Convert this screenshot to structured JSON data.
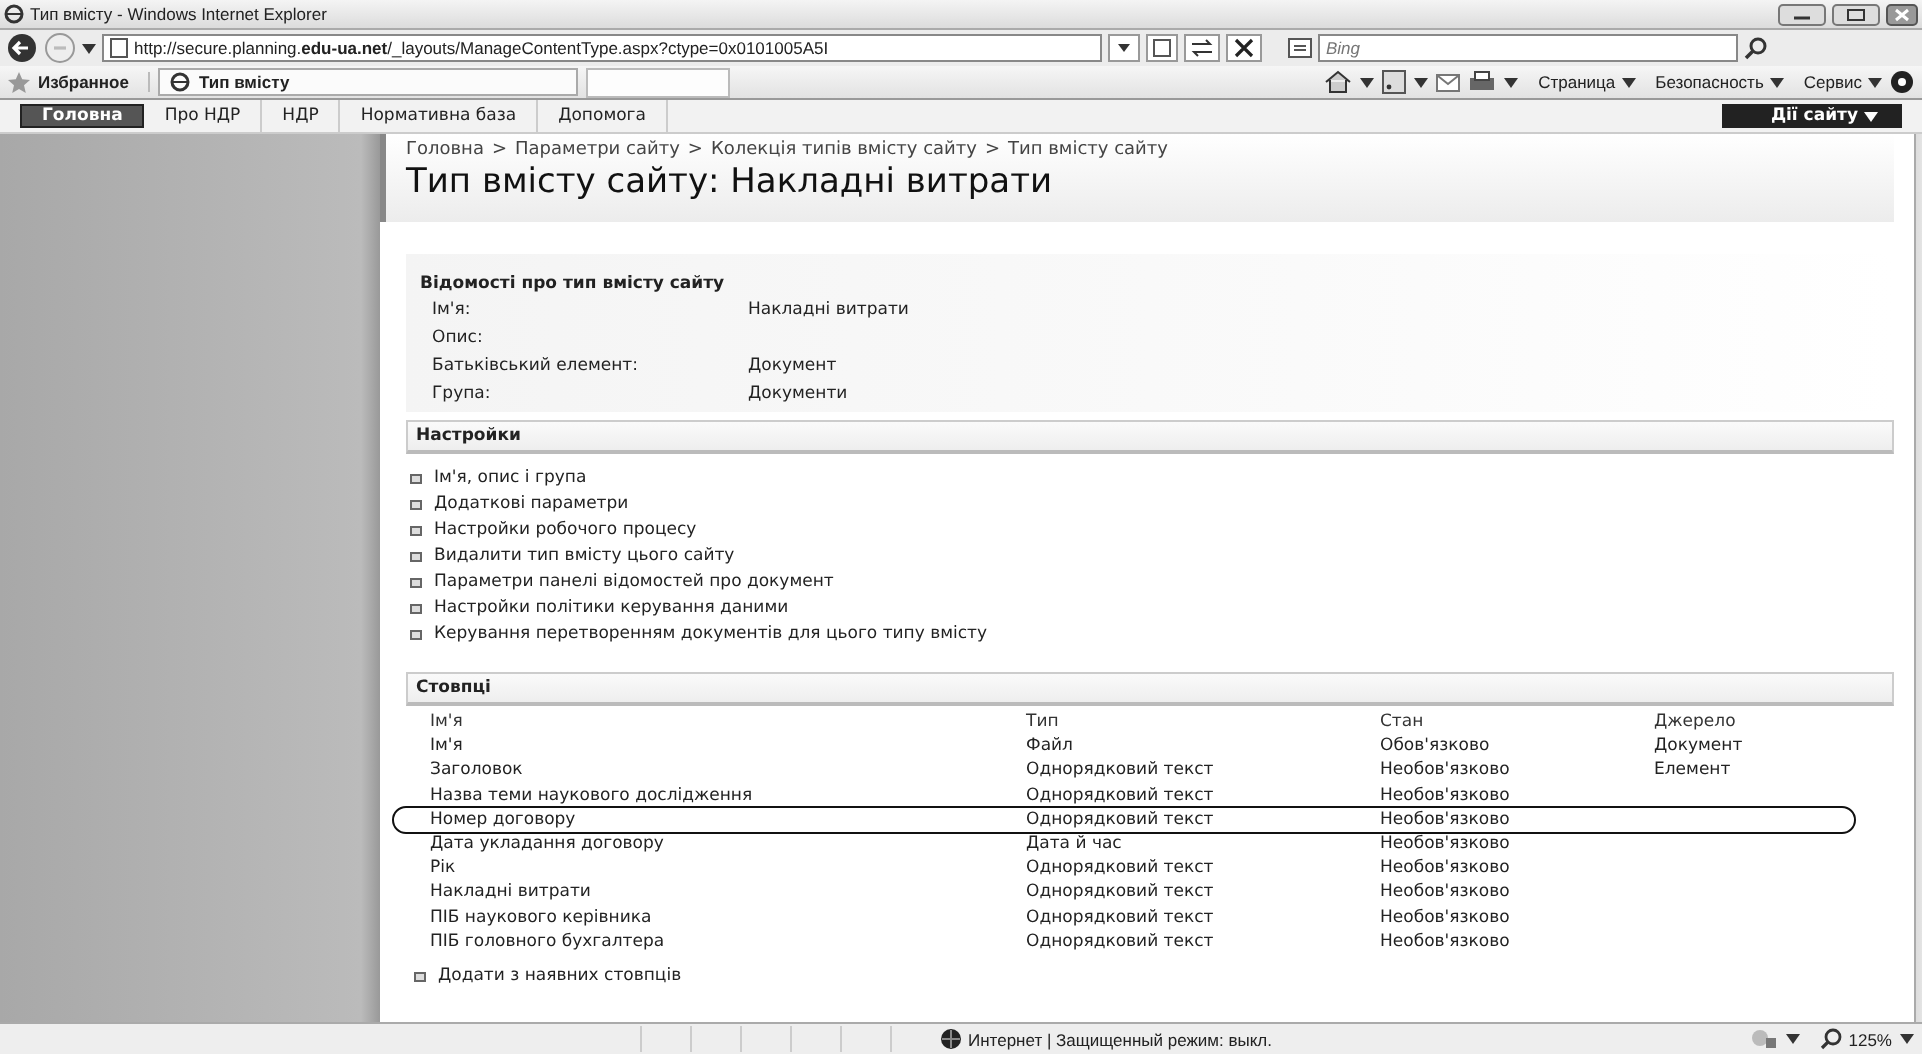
{
  "window": {
    "title": "Тип вмісту - Windows Internet Explorer"
  },
  "address": {
    "url_prefix": "http://secure.planning.",
    "url_domain": "edu-ua.net",
    "url_rest": "/_layouts/ManageContentType.aspx?ctype=0x0101005A5I",
    "search_placeholder": "Bing"
  },
  "favorites_bar": {
    "favorites": "Избранное",
    "tab": "Тип вмісту",
    "menus": [
      "Страница",
      "Безопасность",
      "Сервис"
    ]
  },
  "nav": {
    "tabs": [
      {
        "label": "Головна",
        "selected": true
      },
      {
        "label": "Про НДР",
        "selected": false
      },
      {
        "label": "НДР",
        "selected": false
      },
      {
        "label": "Нормативна база",
        "selected": false
      },
      {
        "label": "Допомога",
        "selected": false
      }
    ],
    "site_actions": "Дії сайту"
  },
  "breadcrumb": [
    {
      "label": "Головна"
    },
    {
      "separator": ">",
      "label": "Параметри сайту"
    },
    {
      "separator": ">",
      "label": "Колекція типів вмісту сайту"
    },
    {
      "separator": ">",
      "label": "Тип вмісту сайту"
    }
  ],
  "page_title": "Тип вмісту сайту: Накладні витрати",
  "info": {
    "heading": "Відомості про тип вмісту сайту",
    "fields": [
      {
        "label": "Ім'я:",
        "value": "Накладні витрати"
      },
      {
        "label": "Опис:"
      },
      {
        "label": "Батьківський елемент:",
        "value": "Документ"
      },
      {
        "label": "Група:",
        "value": "Документи"
      }
    ]
  },
  "settings": {
    "heading": "Настройки",
    "links": [
      "Ім'я, опис і група",
      "Додаткові параметри",
      "Настройки робочого процесу",
      "Видалити тип вмісту цього сайту",
      "Параметри панелі відомостей про документ",
      "Настройки політики керування даними",
      "Керування перетворенням документів для цього типу вмісту"
    ]
  },
  "columns_section": {
    "heading": "Стовпці",
    "table": {
      "columns": [
        "Ім'я",
        "Тип",
        "Стан",
        "Джерело"
      ],
      "rows": [
        {
          "cells": [
            "Ім'я",
            "Файл",
            "Обов'язково",
            "Документ"
          ],
          "circled": false
        },
        {
          "cells": [
            "Заголовок",
            "Однорядковий текст",
            "Необов'язково",
            "Елемент"
          ],
          "circled": false
        },
        {
          "cells": [
            "Назва теми наукового дослідження",
            "Однорядковий текст",
            "Необов'язково"
          ],
          "circled": false
        },
        {
          "cells": [
            "Номер договору",
            "Однорядковий текст",
            "Необов'язково"
          ],
          "circled": true
        },
        {
          "cells": [
            "Дата укладання договору",
            "Дата й час",
            "Необов'язково"
          ],
          "circled": false
        },
        {
          "cells": [
            "Рік",
            "Однорядковий текст",
            "Необов'язково"
          ],
          "circled": false
        },
        {
          "cells": [
            "Накладні витрати",
            "Однорядковий текст",
            "Необов'язково"
          ],
          "circled": false
        },
        {
          "cells": [
            "ПІБ наукового керівника",
            "Однорядковий текст",
            "Необов'язково"
          ],
          "circled": false
        },
        {
          "cells": [
            "ПІБ головного бухгалтера",
            "Однорядковий текст",
            "Необов'язково"
          ],
          "circled": false
        }
      ]
    },
    "add_link": "Додати з наявних стовпців"
  },
  "status_bar": {
    "zone": "Интернет | Защищенный режим: выкл.",
    "zoom": "125%"
  }
}
